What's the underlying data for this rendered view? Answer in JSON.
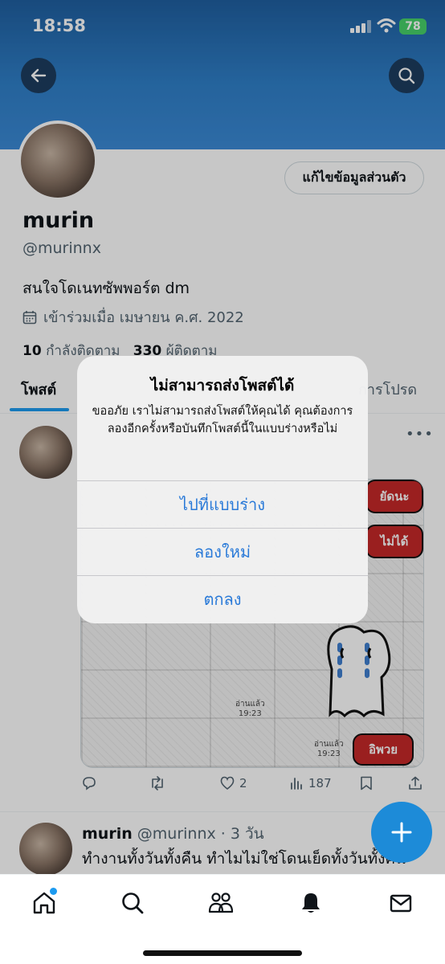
{
  "status_bar": {
    "time": "18:58",
    "battery": "78"
  },
  "profile": {
    "edit_button": "แก้ไขข้อมูลส่วนตัว",
    "name": "murin",
    "handle": "@murinnx",
    "bio": "สนใจโดเนทซัพพอร์ต dm",
    "joined": "เข้าร่วมเมื่อ เมษายน ค.ศ. 2022",
    "following_count": "10",
    "following_label": "กำลังติดตาม",
    "followers_count": "330",
    "followers_label": "ผู้ติดตาม"
  },
  "tabs": {
    "posts": "โพสต์",
    "likes": "การโปรด"
  },
  "post1": {
    "image": {
      "bubble_1": "ยัดนะ",
      "bubble_2": "ไม่ได้",
      "bubble_3": "อิพวย",
      "read_1": "อ่านแล้ว\n19:23",
      "read_2": "อ่านแล้ว\n19:23"
    },
    "likes": "2",
    "views": "187"
  },
  "post2": {
    "name": "murin",
    "handle_time": "@murinnx · 3 วัน",
    "text": "ทำงานทั้งวันทั้งคืน ทำไมไม่ใช่โดนเย็ดทั้งวันทั้งคืน"
  },
  "alert": {
    "title": "ไม่สามารถส่งโพสต์ได้",
    "message": "ขออภัย เราไม่สามารถส่งโพสต์ให้คุณได้ คุณต้องการลองอีกครั้งหรือบันทึกโพสต์นี้ในแบบร่างหรือไม่",
    "btn_drafts": "ไปที่แบบร่าง",
    "btn_retry": "ลองใหม่",
    "btn_ok": "ตกลง"
  },
  "colors": {
    "accent": "#1d9bf0",
    "alert_button": "#2a7ad8",
    "banner": "#2f7fc8"
  }
}
